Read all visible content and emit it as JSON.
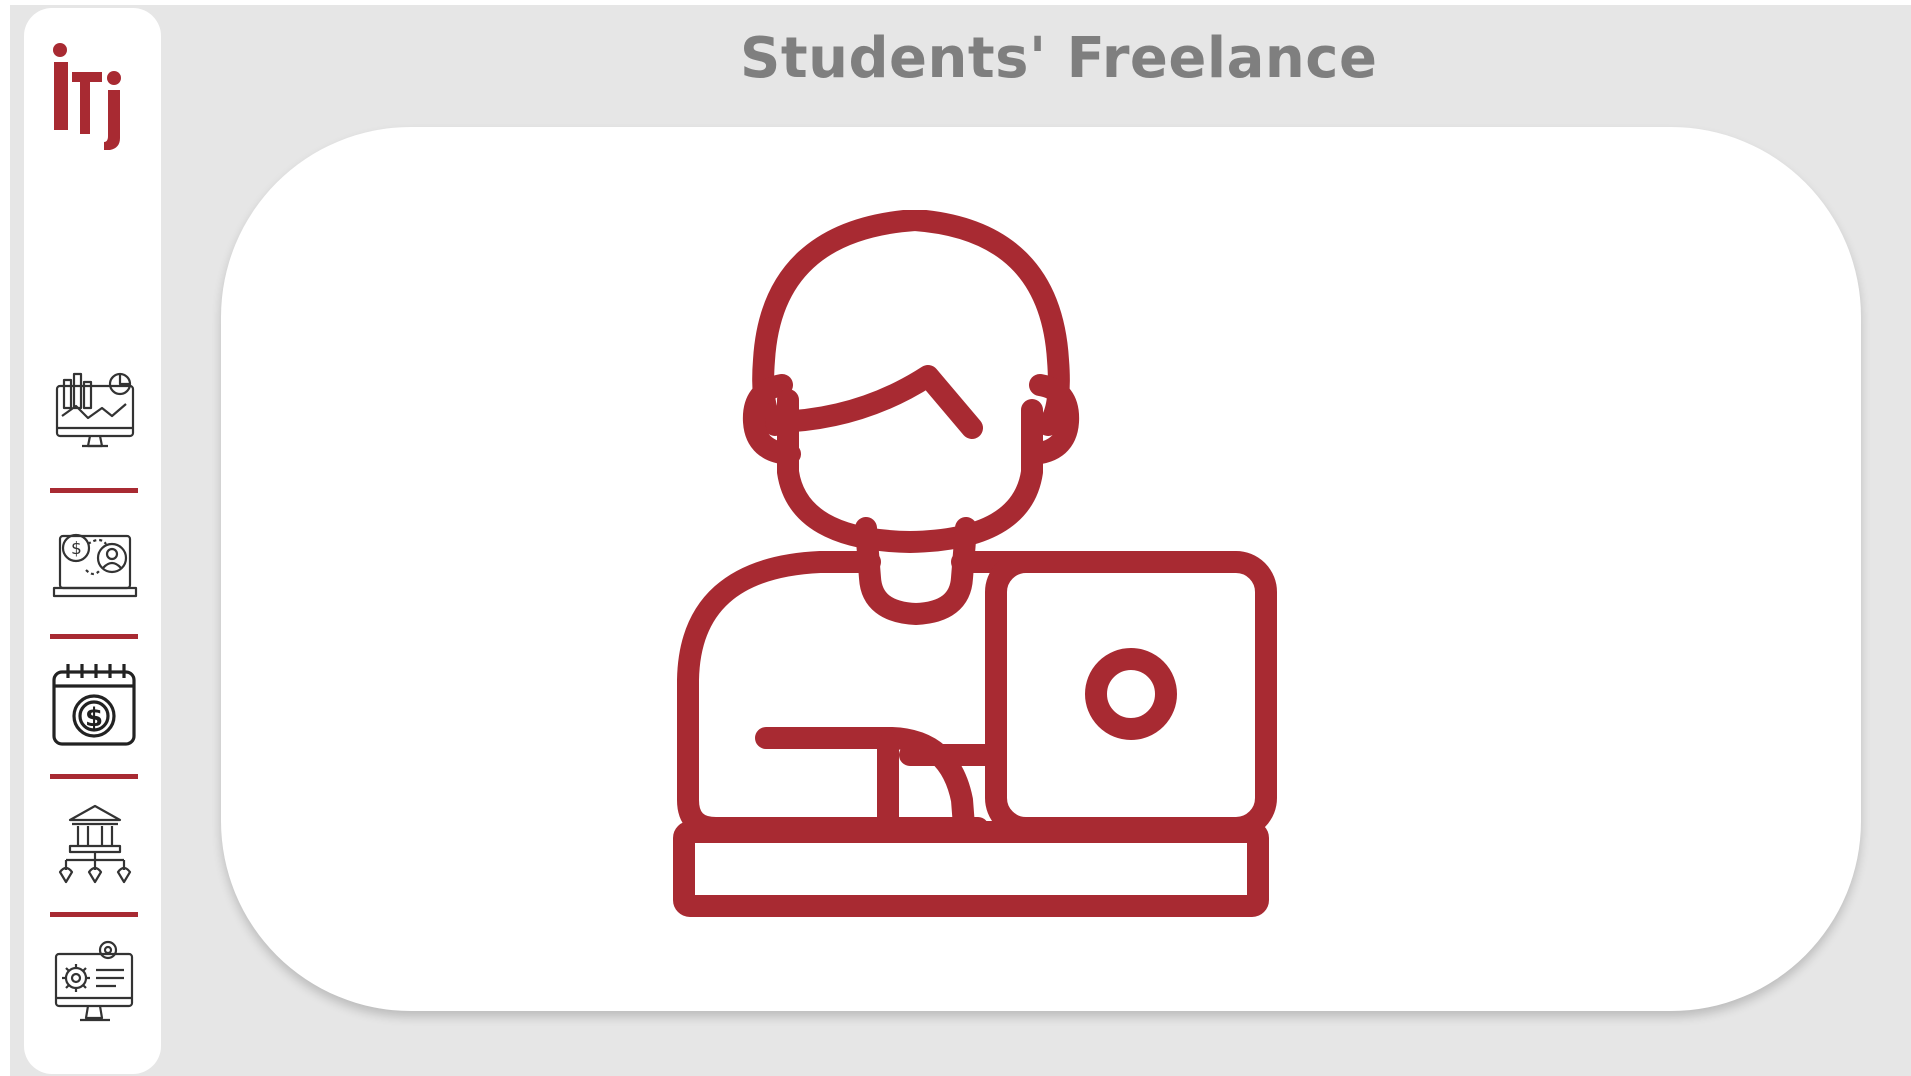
{
  "page": {
    "title": "Students' Freelance"
  },
  "theme": {
    "accent": "#a82a32",
    "title_color": "#7f7f7f",
    "background": "#e6e6e6",
    "panel": "#ffffff"
  },
  "logo": {
    "icon": "iti-logo",
    "text": "iti"
  },
  "sidebar": {
    "items": [
      {
        "icon": "analytics-monitor-icon"
      },
      {
        "icon": "freelancer-payment-laptop-icon"
      },
      {
        "icon": "calendar-dollar-icon"
      },
      {
        "icon": "bank-branches-icon"
      },
      {
        "icon": "settings-monitor-icon"
      }
    ]
  },
  "hero": {
    "icon": "freelancer-laptop-icon"
  }
}
